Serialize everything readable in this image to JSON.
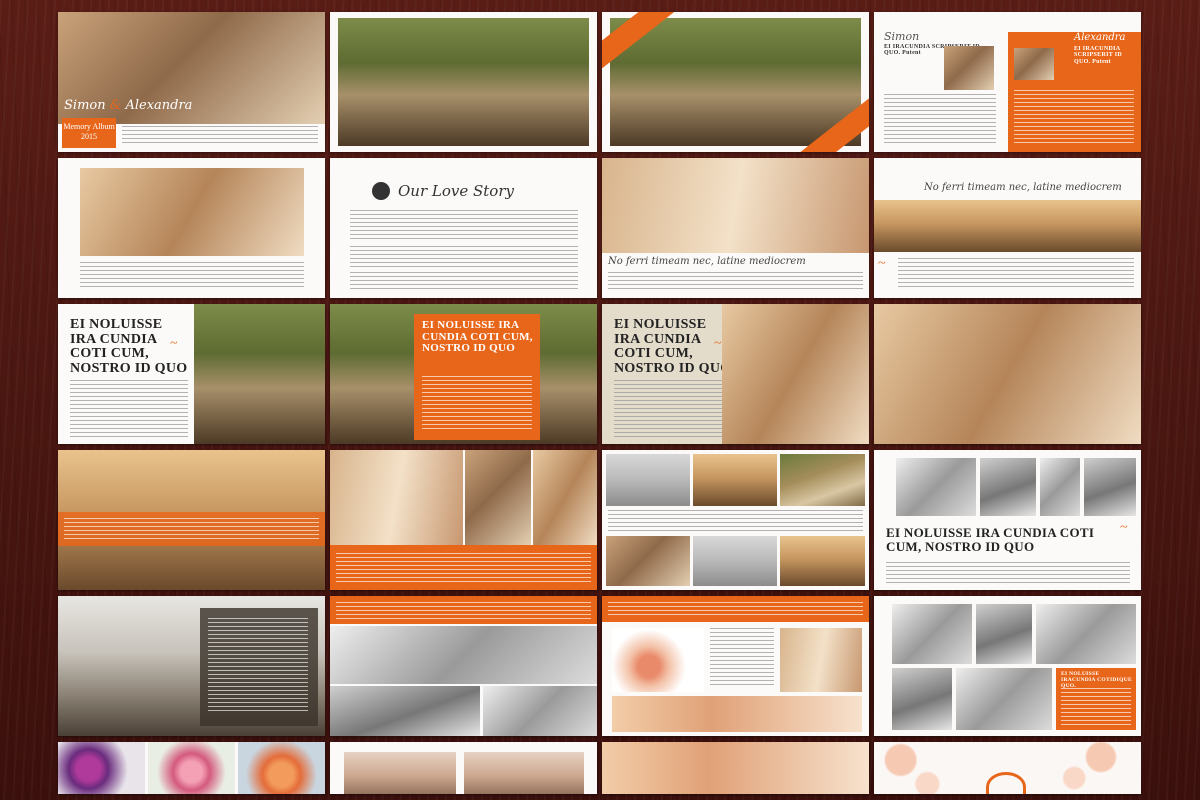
{
  "cover": {
    "names_left": "Simon",
    "names_amp": "&",
    "names_right": "Alexandra",
    "album": "Memory Album",
    "year": "2015"
  },
  "spread": {
    "left_name": "Simon",
    "right_name": "Alexandra",
    "left_heading": "EI IRACUNDIA SCRIPSERIT ID QUO. Putent",
    "right_heading": "EI IRACUNDIA SCRIPSERIT ID QUO. Putent"
  },
  "love_story": {
    "title": "Our Love Story"
  },
  "tagline": "No ferri timeam nec, latine mediocrem",
  "headings": {
    "noluisse_1": "EI NOLUISSE IRA CUNDIA COTI CUM, NOSTRO ID QUO",
    "noluisse_2": "EI NOLUISSE IRA CUNDIA COTI CUM, NOSTRO ID QUO",
    "noluisse_3": "EI NOLUISSE IRA CUNDIA COTI CUM, NOSTRO ID QUO",
    "noluisse_wide": "EI NOLUISSE IRA CUNDIA COTI CUM, NOSTRO ID QUO",
    "noluisse_small": "EI NOLUISSE IRACUNDIA COTIDIQUE QUO."
  },
  "colors": {
    "accent": "#e8661a",
    "background": "#4a1712",
    "page": "#fbfaf8"
  }
}
